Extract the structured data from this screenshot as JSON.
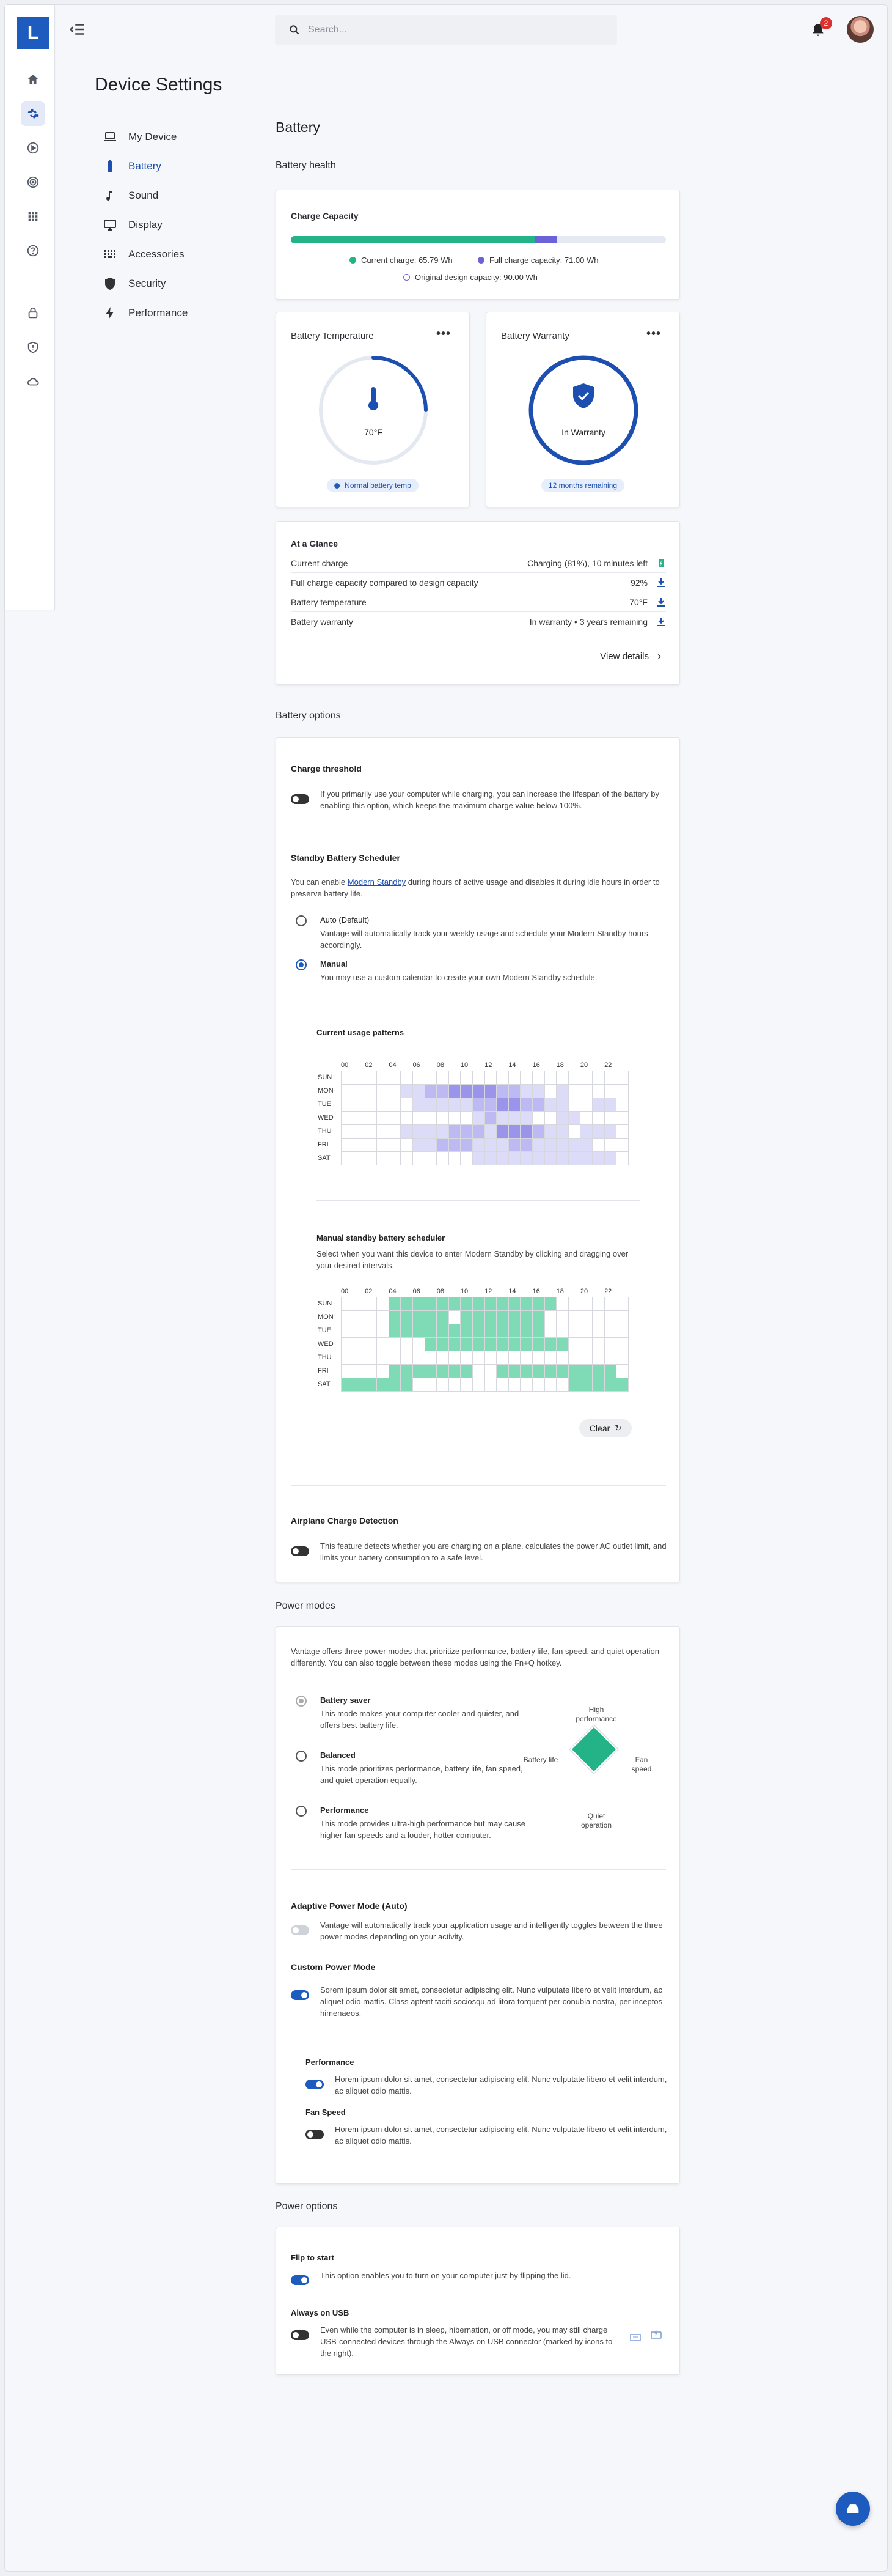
{
  "app": {
    "logo": "L",
    "search_placeholder": "Search...",
    "notifications": "2"
  },
  "page_title": "Device Settings",
  "subnav": [
    {
      "label": "My Device",
      "icon": "laptop-icon"
    },
    {
      "label": "Battery",
      "icon": "battery-icon",
      "active": true
    },
    {
      "label": "Sound",
      "icon": "music-note-icon"
    },
    {
      "label": "Display",
      "icon": "monitor-icon"
    },
    {
      "label": "Accessories",
      "icon": "keyboard-icon"
    },
    {
      "label": "Security",
      "icon": "shield-icon"
    },
    {
      "label": "Performance",
      "icon": "lightning-icon"
    }
  ],
  "battery": {
    "title": "Battery",
    "health_title": "Battery health",
    "capacity": {
      "title": "Charge Capacity",
      "current_pct": 0.65,
      "full_pct": 0.71,
      "current_label": "Current charge:",
      "current_value": "65.79 Wh",
      "full_label": "Full charge capacity:",
      "full_value": "71.00 Wh",
      "design_label": "Original design capacity:",
      "design_value": "90.00 Wh"
    },
    "temperature": {
      "title": "Battery Temperature",
      "value": "70°F",
      "gauge_fraction": 0.25,
      "status": "Normal battery temp"
    },
    "warranty": {
      "title": "Battery Warranty",
      "status": "In Warranty",
      "remaining": "12 months remaining"
    },
    "glance": {
      "title": "At a Glance",
      "rows": [
        {
          "label": "Current charge",
          "value": "Charging (81%), 10 minutes left"
        },
        {
          "label": "Full charge capacity compared to design capacity",
          "value": "92%"
        },
        {
          "label": "Battery temperature",
          "value": "70°F"
        },
        {
          "label": "Battery warranty",
          "value": "In warranty • 3 years remaining"
        }
      ],
      "details": "View details"
    }
  },
  "options": {
    "title": "Battery options",
    "threshold": {
      "title": "Charge threshold",
      "desc": "If you primarily use your computer while charging, you can increase the lifespan of the battery by enabling this option, which keeps the maximum charge value below 100%."
    },
    "standby": {
      "title": "Standby Battery Scheduler",
      "desc_pre": "You can enable ",
      "desc_link": "Modern Standby",
      "desc_post": " during hours of active usage and disables it during idle hours in order to preserve battery life.",
      "auto_label": "Auto (Default)",
      "auto_desc": "Vantage will automatically track your weekly usage and schedule your Modern Standby hours accordingly.",
      "manual_label": "Manual",
      "manual_desc": "You may use a custom calendar to create your own Modern Standby schedule."
    },
    "usage": {
      "title": "Current usage patterns"
    },
    "manual": {
      "title": "Manual standby battery scheduler",
      "desc": "Select when you want this device to enter Modern Standby by clicking and dragging over your desired intervals.",
      "clear": "Clear"
    },
    "hours": [
      "00",
      "02",
      "04",
      "06",
      "08",
      "10",
      "12",
      "14",
      "16",
      "18",
      "20",
      "22"
    ],
    "days": [
      "SUN",
      "MON",
      "TUE",
      "WED",
      "THU",
      "FRI",
      "SAT"
    ],
    "usage_grid": [
      [
        0,
        0,
        0,
        0,
        0,
        0,
        0,
        0,
        0,
        0,
        0,
        0,
        0,
        0,
        0,
        0,
        0,
        0,
        0,
        0,
        0,
        0,
        0,
        0
      ],
      [
        0,
        0,
        0,
        0,
        0,
        1,
        1,
        2,
        2,
        3,
        3,
        3,
        3,
        2,
        2,
        1,
        1,
        0,
        1,
        0,
        0,
        0,
        0,
        0
      ],
      [
        0,
        0,
        0,
        0,
        0,
        0,
        1,
        1,
        1,
        1,
        1,
        2,
        2,
        3,
        3,
        2,
        2,
        1,
        1,
        0,
        0,
        1,
        1,
        0
      ],
      [
        0,
        0,
        0,
        0,
        0,
        0,
        0,
        0,
        0,
        0,
        0,
        1,
        2,
        1,
        1,
        1,
        0,
        0,
        1,
        1,
        0,
        0,
        0,
        0
      ],
      [
        0,
        0,
        0,
        0,
        0,
        1,
        1,
        1,
        1,
        2,
        2,
        2,
        1,
        3,
        3,
        3,
        2,
        1,
        1,
        0,
        1,
        1,
        1,
        0
      ],
      [
        0,
        0,
        0,
        0,
        0,
        0,
        1,
        1,
        2,
        2,
        2,
        1,
        1,
        1,
        2,
        2,
        1,
        1,
        1,
        1,
        1,
        0,
        0,
        0
      ],
      [
        0,
        0,
        0,
        0,
        0,
        0,
        0,
        0,
        0,
        0,
        0,
        1,
        1,
        1,
        1,
        1,
        1,
        1,
        1,
        1,
        1,
        1,
        1,
        0
      ]
    ],
    "manual_grid": [
      [
        0,
        0,
        0,
        0,
        1,
        1,
        1,
        1,
        1,
        1,
        1,
        1,
        1,
        1,
        1,
        1,
        1,
        1,
        0,
        0,
        0,
        0,
        0,
        0
      ],
      [
        0,
        0,
        0,
        0,
        1,
        1,
        1,
        1,
        1,
        0,
        1,
        1,
        1,
        1,
        1,
        1,
        1,
        0,
        0,
        0,
        0,
        0,
        0,
        0
      ],
      [
        0,
        0,
        0,
        0,
        1,
        1,
        1,
        1,
        1,
        1,
        1,
        1,
        1,
        1,
        1,
        1,
        1,
        0,
        0,
        0,
        0,
        0,
        0,
        0
      ],
      [
        0,
        0,
        0,
        0,
        0,
        0,
        0,
        1,
        1,
        1,
        1,
        1,
        1,
        1,
        1,
        1,
        1,
        1,
        1,
        0,
        0,
        0,
        0,
        0
      ],
      [
        0,
        0,
        0,
        0,
        0,
        0,
        0,
        0,
        0,
        0,
        0,
        0,
        0,
        0,
        0,
        0,
        0,
        0,
        0,
        0,
        0,
        0,
        0,
        0
      ],
      [
        0,
        0,
        0,
        0,
        1,
        1,
        1,
        1,
        1,
        1,
        1,
        0,
        0,
        1,
        1,
        1,
        1,
        1,
        1,
        1,
        1,
        1,
        1,
        0
      ],
      [
        1,
        1,
        1,
        1,
        1,
        1,
        0,
        0,
        0,
        0,
        0,
        0,
        0,
        0,
        0,
        0,
        0,
        0,
        0,
        1,
        1,
        1,
        1,
        1
      ]
    ],
    "airplane": {
      "title": "Airplane Charge Detection",
      "desc": "This feature detects whether you are charging on a plane, calculates the power AC outlet limit, and limits your battery consumption to a safe level."
    }
  },
  "power_modes": {
    "title": "Power modes",
    "intro": "Vantage offers three power modes that prioritize performance, battery life, fan speed, and quiet operation differently. You can also toggle between these modes using the Fn+Q hotkey.",
    "modes": [
      {
        "label": "Battery saver",
        "desc": "This mode makes your computer cooler and quieter, and offers best battery life."
      },
      {
        "label": "Balanced",
        "desc": "This mode prioritizes performance, battery life, fan speed, and quiet operation equally."
      },
      {
        "label": "Performance",
        "desc": "This mode provides ultra-high performance but may cause higher fan speeds and a louder, hotter computer."
      }
    ],
    "radar": {
      "top": "High performance",
      "left": "Battery life",
      "right": "Fan speed",
      "bottom": "Quiet operation"
    },
    "adaptive": {
      "title": "Adaptive Power Mode (Auto)",
      "desc": "Vantage will automatically track your application usage and intelligently toggles between the three power modes depending on your activity."
    },
    "custom": {
      "title": "Custom Power Mode",
      "desc": "Sorem ipsum dolor sit amet, consectetur adipiscing elit. Nunc vulputate libero et velit interdum, ac aliquet odio mattis. Class aptent taciti sociosqu ad litora torquent per conubia nostra, per inceptos himenaeos."
    },
    "perf": {
      "title": "Performance",
      "desc": "Horem ipsum dolor sit amet, consectetur adipiscing elit. Nunc vulputate libero et velit interdum, ac aliquet odio mattis."
    },
    "fan": {
      "title": "Fan Speed",
      "desc": "Horem ipsum dolor sit amet, consectetur adipiscing elit. Nunc vulputate libero et velit interdum, ac aliquet odio mattis."
    }
  },
  "power_options": {
    "title": "Power options",
    "flip": {
      "title": "Flip to start",
      "desc": "This option enables you to turn on your computer just by flipping the lid."
    },
    "usb": {
      "title": "Always on USB",
      "desc": "Even while the computer is in sleep, hibernation, or off mode, you may still charge USB-connected devices through the Always on USB connector (marked by icons to the right)."
    }
  },
  "colors": {
    "accent": "#1d5bbf",
    "green": "#24b387",
    "purple": "#6b61d8",
    "usage": [
      "#ffffff",
      "#dcdcf8",
      "#bdbaf3",
      "#9a95ea"
    ],
    "manual": "#7fdbb6"
  }
}
